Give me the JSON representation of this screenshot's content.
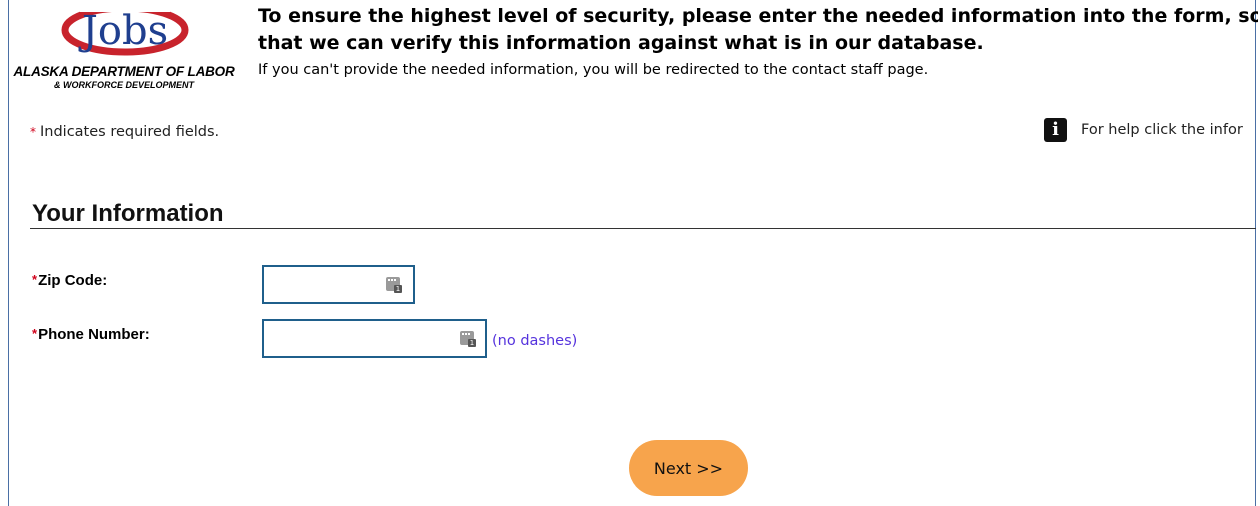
{
  "logo": {
    "wordmark": "Jobs",
    "agency": "ALASKA DEPARTMENT OF LABOR",
    "subtitle": "& WORKFORCE DEVELOPMENT"
  },
  "header": {
    "headline_line1": "To ensure the highest level of security, please enter the needed information into the form, so",
    "headline_line2": "that we can verify this information against what is in our database.",
    "note": "If you can't provide the needed information, you will be redirected to the contact staff page."
  },
  "required_note": {
    "marker": "*",
    "text": "Indicates required fields."
  },
  "help": {
    "icon": "info-icon",
    "icon_glyph": "i",
    "text": "For help click the infor"
  },
  "section": {
    "title": "Your Information"
  },
  "form": {
    "fields": [
      {
        "label": "Zip Code:",
        "required_marker": "*",
        "value": "",
        "icon": "autofill-icon"
      },
      {
        "label": "Phone Number:",
        "required_marker": "*",
        "value": "",
        "icon": "autofill-icon",
        "hint": "(no dashes)"
      }
    ],
    "submit_label": "Next >>"
  },
  "colors": {
    "required": "#d0021b",
    "input_border": "#1f5f8b",
    "hint": "#5533dd",
    "button": "#f7a44c",
    "logo_red": "#c8232c",
    "logo_blue": "#1f3f8f"
  }
}
